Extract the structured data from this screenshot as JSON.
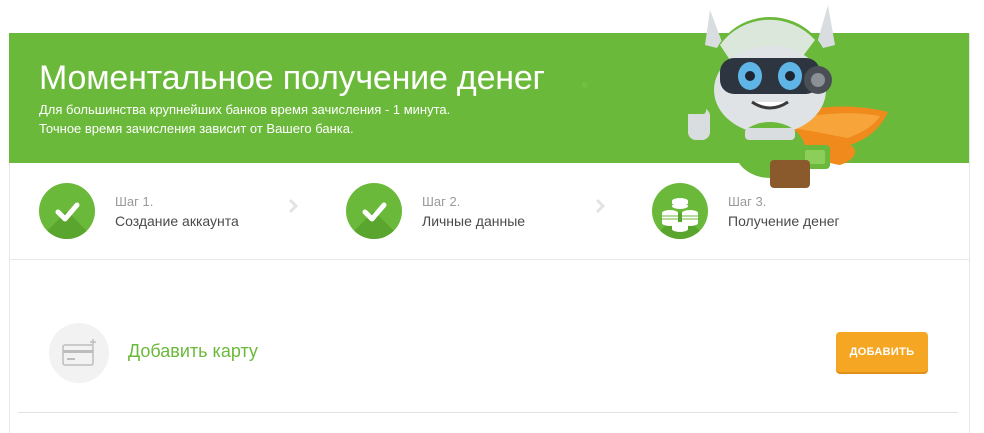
{
  "banner": {
    "title": "Моментальное получение денег",
    "subtitle_line1": "Для большинства крупнейших банков время зачисления - 1 минута.",
    "subtitle_line2": "Точное время зачисления зависит от Вашего банка."
  },
  "steps": [
    {
      "number": "Шаг 1.",
      "name": "Создание аккаунта",
      "status": "completed",
      "icon": "checkmark-icon"
    },
    {
      "number": "Шаг 2.",
      "name": "Личные данные",
      "status": "completed",
      "icon": "checkmark-icon"
    },
    {
      "number": "Шаг 3.",
      "name": "Получение денег",
      "status": "current",
      "icon": "coins-icon"
    }
  ],
  "add_card": {
    "label": "Добавить карту",
    "button_label": "ДОБАВИТЬ",
    "icon": "credit-card-add-icon"
  },
  "colors": {
    "brand_green": "#6bb93a",
    "button_orange": "#f5a623"
  }
}
